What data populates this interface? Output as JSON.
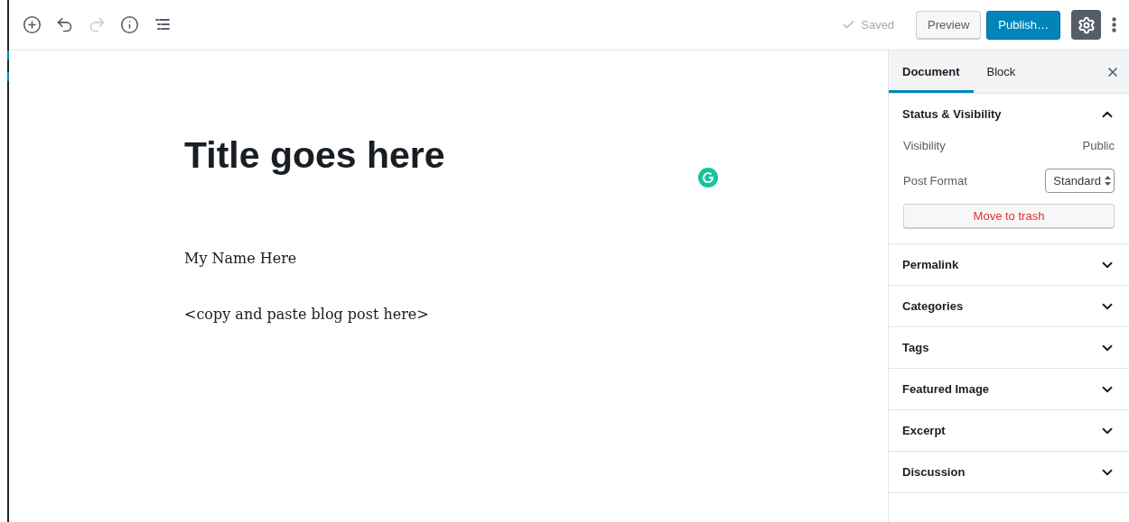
{
  "toolbar": {
    "undo_disabled": false,
    "redo_disabled": true,
    "saved": "Saved",
    "preview": "Preview",
    "publish": "Publish…",
    "settings_selected": true
  },
  "editor": {
    "title": "Title goes here",
    "paragraphs": [
      "My Name Here",
      "<copy and paste blog post here>"
    ]
  },
  "sidebar": {
    "tabs": [
      {
        "label": "Document",
        "selected": true
      },
      {
        "label": "Block",
        "selected": false
      }
    ],
    "panels": [
      {
        "title": "Status & Visibility",
        "expanded": true,
        "rows": [
          {
            "kind": "text",
            "label": "Visibility",
            "value": "Public"
          },
          {
            "kind": "select",
            "label": "Post Format",
            "value": "Standard"
          }
        ],
        "trash": "Move to trash"
      },
      {
        "title": "Permalink",
        "expanded": false
      },
      {
        "title": "Categories",
        "expanded": false
      },
      {
        "title": "Tags",
        "expanded": false
      },
      {
        "title": "Featured Image",
        "expanded": false
      },
      {
        "title": "Excerpt",
        "expanded": false
      },
      {
        "title": "Discussion",
        "expanded": false
      }
    ]
  }
}
